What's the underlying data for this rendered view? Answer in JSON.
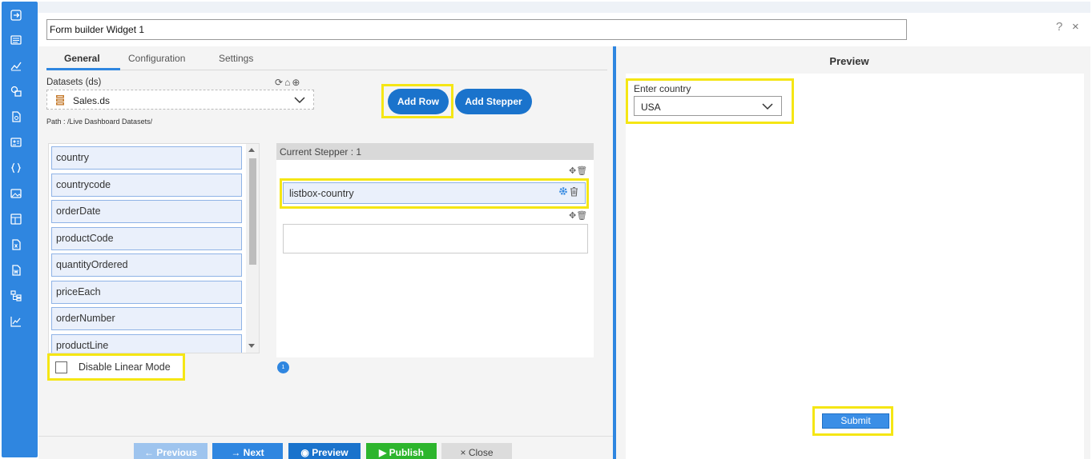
{
  "rail": {
    "icons": [
      "login-icon",
      "list-icon",
      "analytics-icon",
      "shapes-icon",
      "document-icon",
      "contact-card-icon",
      "code-braces-icon",
      "image-icon",
      "dashboard-icon",
      "excel-icon",
      "word-icon",
      "hierarchy-icon",
      "line-chart-icon"
    ]
  },
  "widget": {
    "name": "Form builder Widget 1"
  },
  "window": {
    "help": "?",
    "close": "×"
  },
  "tabs": [
    {
      "label": "General"
    },
    {
      "label": "Configuration"
    },
    {
      "label": "Settings"
    }
  ],
  "datasets": {
    "label": "Datasets (ds)",
    "selected": "Sales.ds",
    "path": "Path : /Live Dashboard Datasets/"
  },
  "toolbar": {
    "add_row": "Add Row",
    "add_stepper": "Add Stepper"
  },
  "fields": [
    "country",
    "countrycode",
    "orderDate",
    "productCode",
    "quantityOrdered",
    "priceEach",
    "orderNumber",
    "productLine"
  ],
  "options": {
    "disable_linear_mode": "Disable Linear Mode",
    "disable_linear_mode_checked": false
  },
  "stepper": {
    "header": "Current Stepper : 1",
    "item_label": "listbox-country",
    "step_number": "1"
  },
  "footer": {
    "previous": "Previous",
    "next": "Next",
    "preview": "Preview",
    "publish": "Publish",
    "close": "Close"
  },
  "preview": {
    "title": "Preview",
    "field_label": "Enter country",
    "field_value": "USA",
    "submit": "Submit"
  },
  "colors": {
    "accent": "#2f86e0",
    "highlight": "#f5e614",
    "button": "#1a73cc",
    "publish": "#2db52d"
  }
}
